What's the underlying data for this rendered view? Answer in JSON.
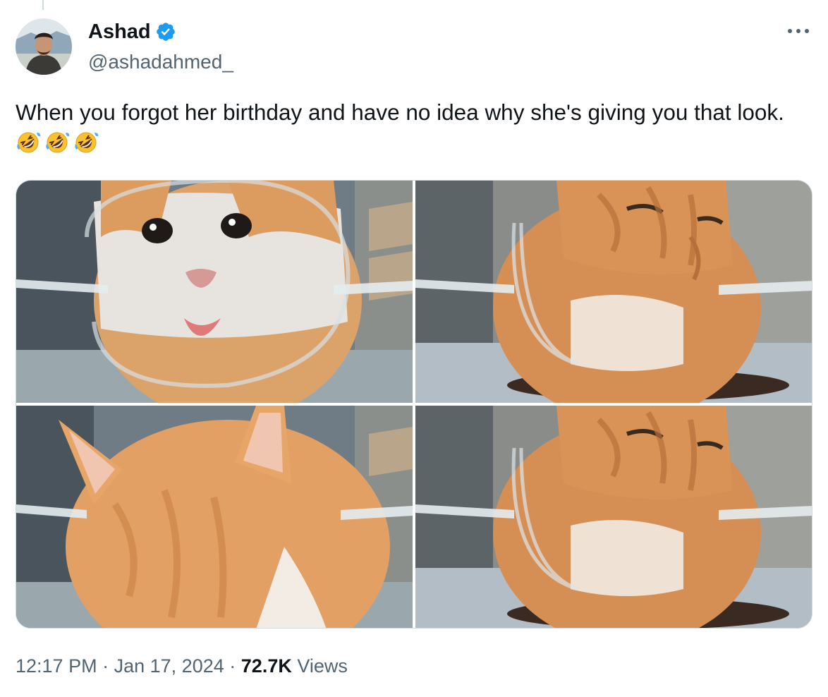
{
  "author": {
    "display_name": "Ashad",
    "handle": "@ashadahmed_",
    "verified": true,
    "verified_color": "#1d9bf0"
  },
  "tweet": {
    "text": "When you forgot her birthday and have no idea why she's giving you that look.",
    "emojis": [
      "rolling-on-floor-laughing",
      "rolling-on-floor-laughing",
      "rolling-on-floor-laughing"
    ]
  },
  "media": {
    "count": 4,
    "items": [
      {
        "subject": "white-and-orange cat with surprised expression behind glass bowl"
      },
      {
        "subject": "orange tabby cat squinting behind glass bowl"
      },
      {
        "subject": "orange cat turning head away behind glass bowl"
      },
      {
        "subject": "orange tabby cat squinting behind glass bowl"
      }
    ]
  },
  "meta": {
    "time": "12:17 PM",
    "date": "Jan 17, 2024",
    "separator": "·",
    "views_count": "72.7K",
    "views_label": "Views"
  },
  "icons": {
    "more": "more-horizontal-icon",
    "verified": "verified-badge-icon"
  },
  "colors": {
    "text": "#0f1419",
    "secondary": "#536471",
    "border": "#cfd9de",
    "accent": "#1d9bf0"
  }
}
